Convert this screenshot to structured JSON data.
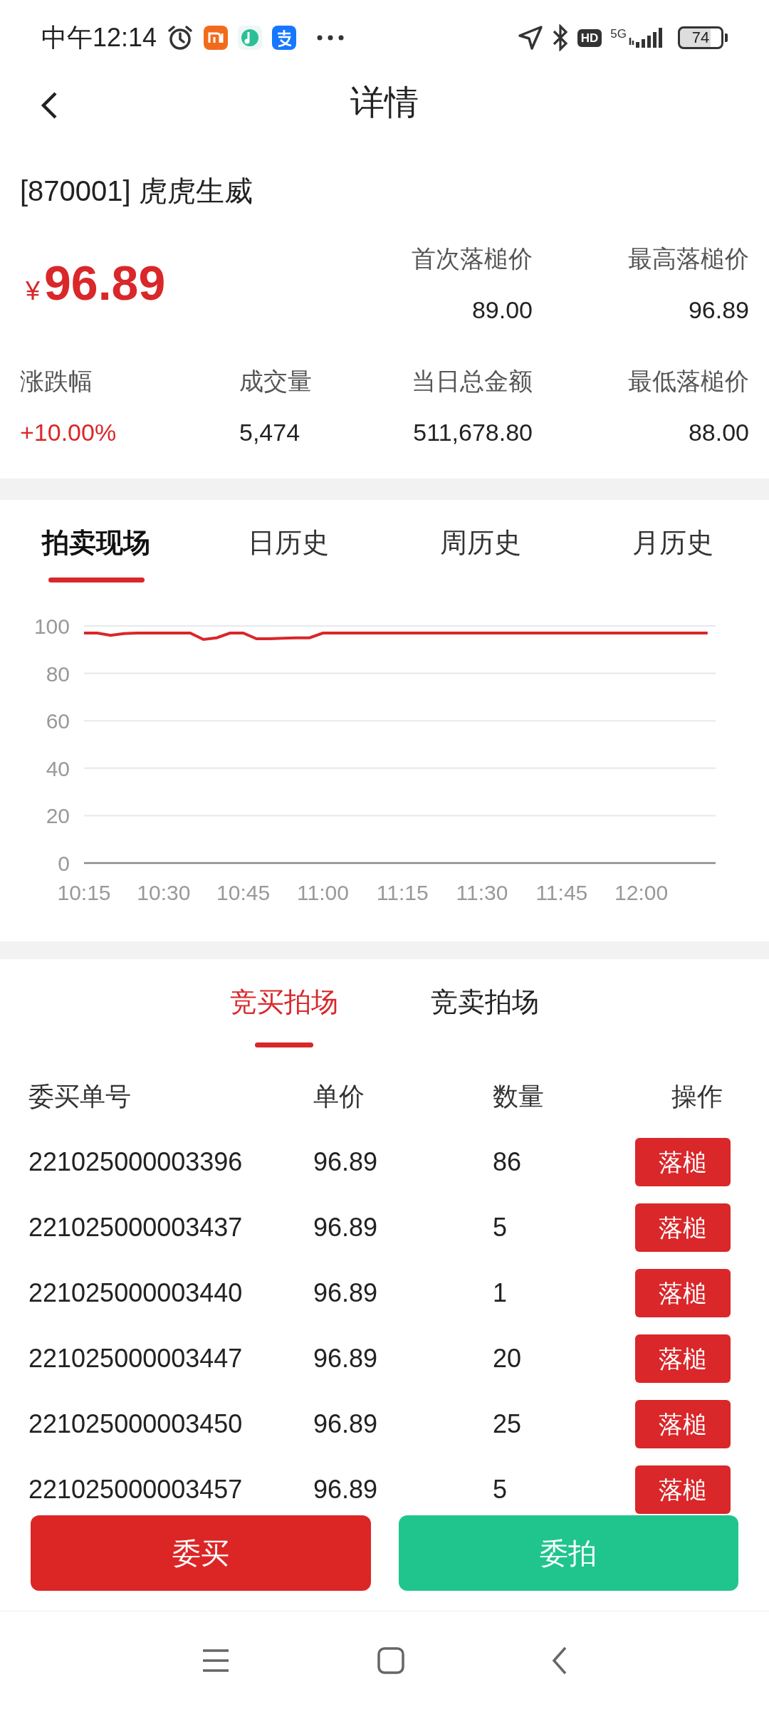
{
  "status_bar": {
    "time": "中午12:14",
    "hd": "HD",
    "network": "5G",
    "battery": "74"
  },
  "header": {
    "title": "详情"
  },
  "product": {
    "name": "[870001] 虎虎生威",
    "currency": "¥",
    "price": "96.89"
  },
  "stats_top": [
    {
      "label": "首次落槌价",
      "value": "89.00"
    },
    {
      "label": "最高落槌价",
      "value": "96.89"
    }
  ],
  "stats_bottom": [
    {
      "label": "涨跌幅",
      "value": "+10.00%",
      "kind": "change"
    },
    {
      "label": "成交量",
      "value": "5,474",
      "kind": "plain"
    },
    {
      "label": "当日总金额",
      "value": "511,678.80",
      "kind": "plain"
    },
    {
      "label": "最低落槌价",
      "value": "88.00",
      "kind": "plain"
    }
  ],
  "chart_tabs": [
    {
      "label": "拍卖现场",
      "selected": true
    },
    {
      "label": "日历史",
      "selected": false
    },
    {
      "label": "周历史",
      "selected": false
    },
    {
      "label": "月历史",
      "selected": false
    }
  ],
  "chart": {
    "chart_data": {
      "type": "line",
      "categories": [
        "10:15",
        null,
        null,
        null,
        null,
        null,
        "10:30",
        null,
        null,
        null,
        null,
        null,
        "10:45",
        null,
        null,
        null,
        null,
        null,
        "11:00",
        null,
        null,
        null,
        null,
        null,
        "11:15",
        null,
        null,
        null,
        null,
        null,
        "11:30",
        null,
        null,
        null,
        null,
        null,
        "11:45",
        null,
        null,
        null,
        null,
        null,
        "12:00",
        null,
        null,
        null,
        null,
        null
      ],
      "series": [
        {
          "color": "#d9272a",
          "values": [
            97,
            97,
            96,
            96.8,
            97,
            97,
            97,
            97,
            97,
            94.3,
            95,
            97,
            97,
            94.6,
            94.6,
            94.8,
            95,
            95,
            97,
            97,
            97,
            97,
            97,
            97,
            97,
            97,
            97,
            97,
            97,
            97,
            97,
            97,
            97,
            97,
            97,
            97,
            97,
            97,
            97,
            97,
            97,
            97,
            97,
            97,
            97,
            97,
            97,
            97
          ]
        }
      ],
      "ylim": [
        0,
        100
      ],
      "grid": true,
      "yticks": [
        0,
        20,
        40,
        60,
        80,
        100
      ]
    }
  },
  "market_tabs": [
    {
      "label": "竞买拍场",
      "selected": true
    },
    {
      "label": "竞卖拍场",
      "selected": false
    }
  ],
  "table": {
    "columns": [
      "委买单号",
      "单价",
      "数量",
      "操作"
    ],
    "rows": [
      {
        "order_no": "221025000003396",
        "price": "96.89",
        "quantity": "86",
        "action": "落槌"
      },
      {
        "order_no": "221025000003437",
        "price": "96.89",
        "quantity": "5",
        "action": "落槌"
      },
      {
        "order_no": "221025000003440",
        "price": "96.89",
        "quantity": "1",
        "action": "落槌"
      },
      {
        "order_no": "221025000003447",
        "price": "96.89",
        "quantity": "20",
        "action": "落槌"
      },
      {
        "order_no": "221025000003450",
        "price": "96.89",
        "quantity": "25",
        "action": "落槌"
      },
      {
        "order_no": "221025000003457",
        "price": "96.89",
        "quantity": "5",
        "action": "落槌"
      }
    ]
  },
  "actions": [
    {
      "label": "委买",
      "kind": "buy"
    },
    {
      "label": "委拍",
      "kind": "sell"
    }
  ]
}
